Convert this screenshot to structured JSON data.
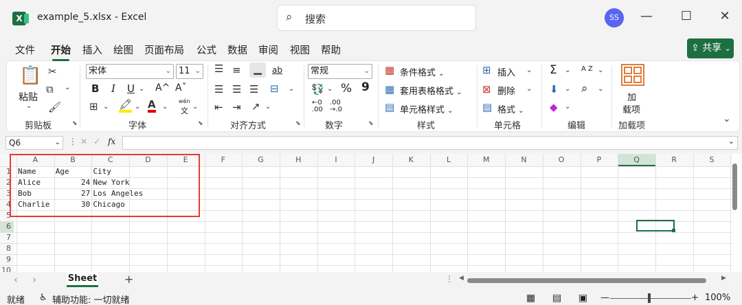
{
  "window": {
    "app_icon": "X",
    "title": "example_5.xlsx  -  Excel",
    "search_placeholder": "搜索",
    "avatar_initials": "SS",
    "minimize": "—",
    "maximize": "☐",
    "close": "✕"
  },
  "menu": {
    "tabs": [
      "文件",
      "开始",
      "插入",
      "绘图",
      "页面布局",
      "公式",
      "数据",
      "审阅",
      "视图",
      "帮助"
    ],
    "active_tab": "开始",
    "share_label": "共享",
    "share_caret": "⌄"
  },
  "ribbon": {
    "clipboard": {
      "label": "剪贴板",
      "paste": "粘贴"
    },
    "font": {
      "label": "字体",
      "font_name": "宋体",
      "font_size": "11",
      "bold": "B",
      "italic": "I",
      "underline": "U",
      "grow": "A^",
      "shrink": "Aˇ",
      "phonetic_top": "wén",
      "phonetic_bottom": "文"
    },
    "alignment": {
      "label": "对齐方式",
      "wrap": "ab"
    },
    "number": {
      "label": "数字",
      "format": "常规",
      "percent": "%",
      "comma": "9",
      "inc_decimal": ".00",
      "dec_decimal": ".0"
    },
    "styles": {
      "label": "样式",
      "conditional": "条件格式",
      "table": "套用表格格式",
      "cell_styles": "单元格样式"
    },
    "cells": {
      "label": "单元格",
      "insert": "插入",
      "delete": "删除",
      "format": "格式"
    },
    "editing": {
      "label": "编辑",
      "sum": "Σ",
      "sort": "A Z",
      "find": "⌕"
    },
    "addins": {
      "label": "加载项",
      "btn_line1": "加",
      "btn_line2": "载项"
    },
    "accent": "#1d6f42"
  },
  "formula_bar": {
    "name_box": "Q6",
    "fx": "fx"
  },
  "grid": {
    "columns": [
      "A",
      "B",
      "C",
      "D",
      "E",
      "F",
      "G",
      "H",
      "I",
      "J",
      "K",
      "L",
      "M",
      "N",
      "O",
      "P",
      "Q",
      "R",
      "S"
    ],
    "rows": [
      "1",
      "2",
      "3",
      "4",
      "5",
      "6",
      "7",
      "8",
      "9",
      "10"
    ],
    "header": [
      "Name",
      "Age",
      "City"
    ],
    "data": [
      [
        "Alice",
        "24",
        "New York"
      ],
      [
        "Bob",
        "27",
        "Los Angeles"
      ],
      [
        "Charlie",
        "30",
        "Chicago"
      ]
    ],
    "selected_cell": "Q6",
    "highlight_color": "#e53935"
  },
  "sheets": {
    "tabs": [
      "Sheet"
    ],
    "add": "+",
    "prev": "‹",
    "next": "›"
  },
  "status": {
    "ready": "就绪",
    "accessibility": "辅助功能: 一切就绪",
    "zoom": "100%",
    "zoom_minus": "—",
    "zoom_plus": "+"
  }
}
